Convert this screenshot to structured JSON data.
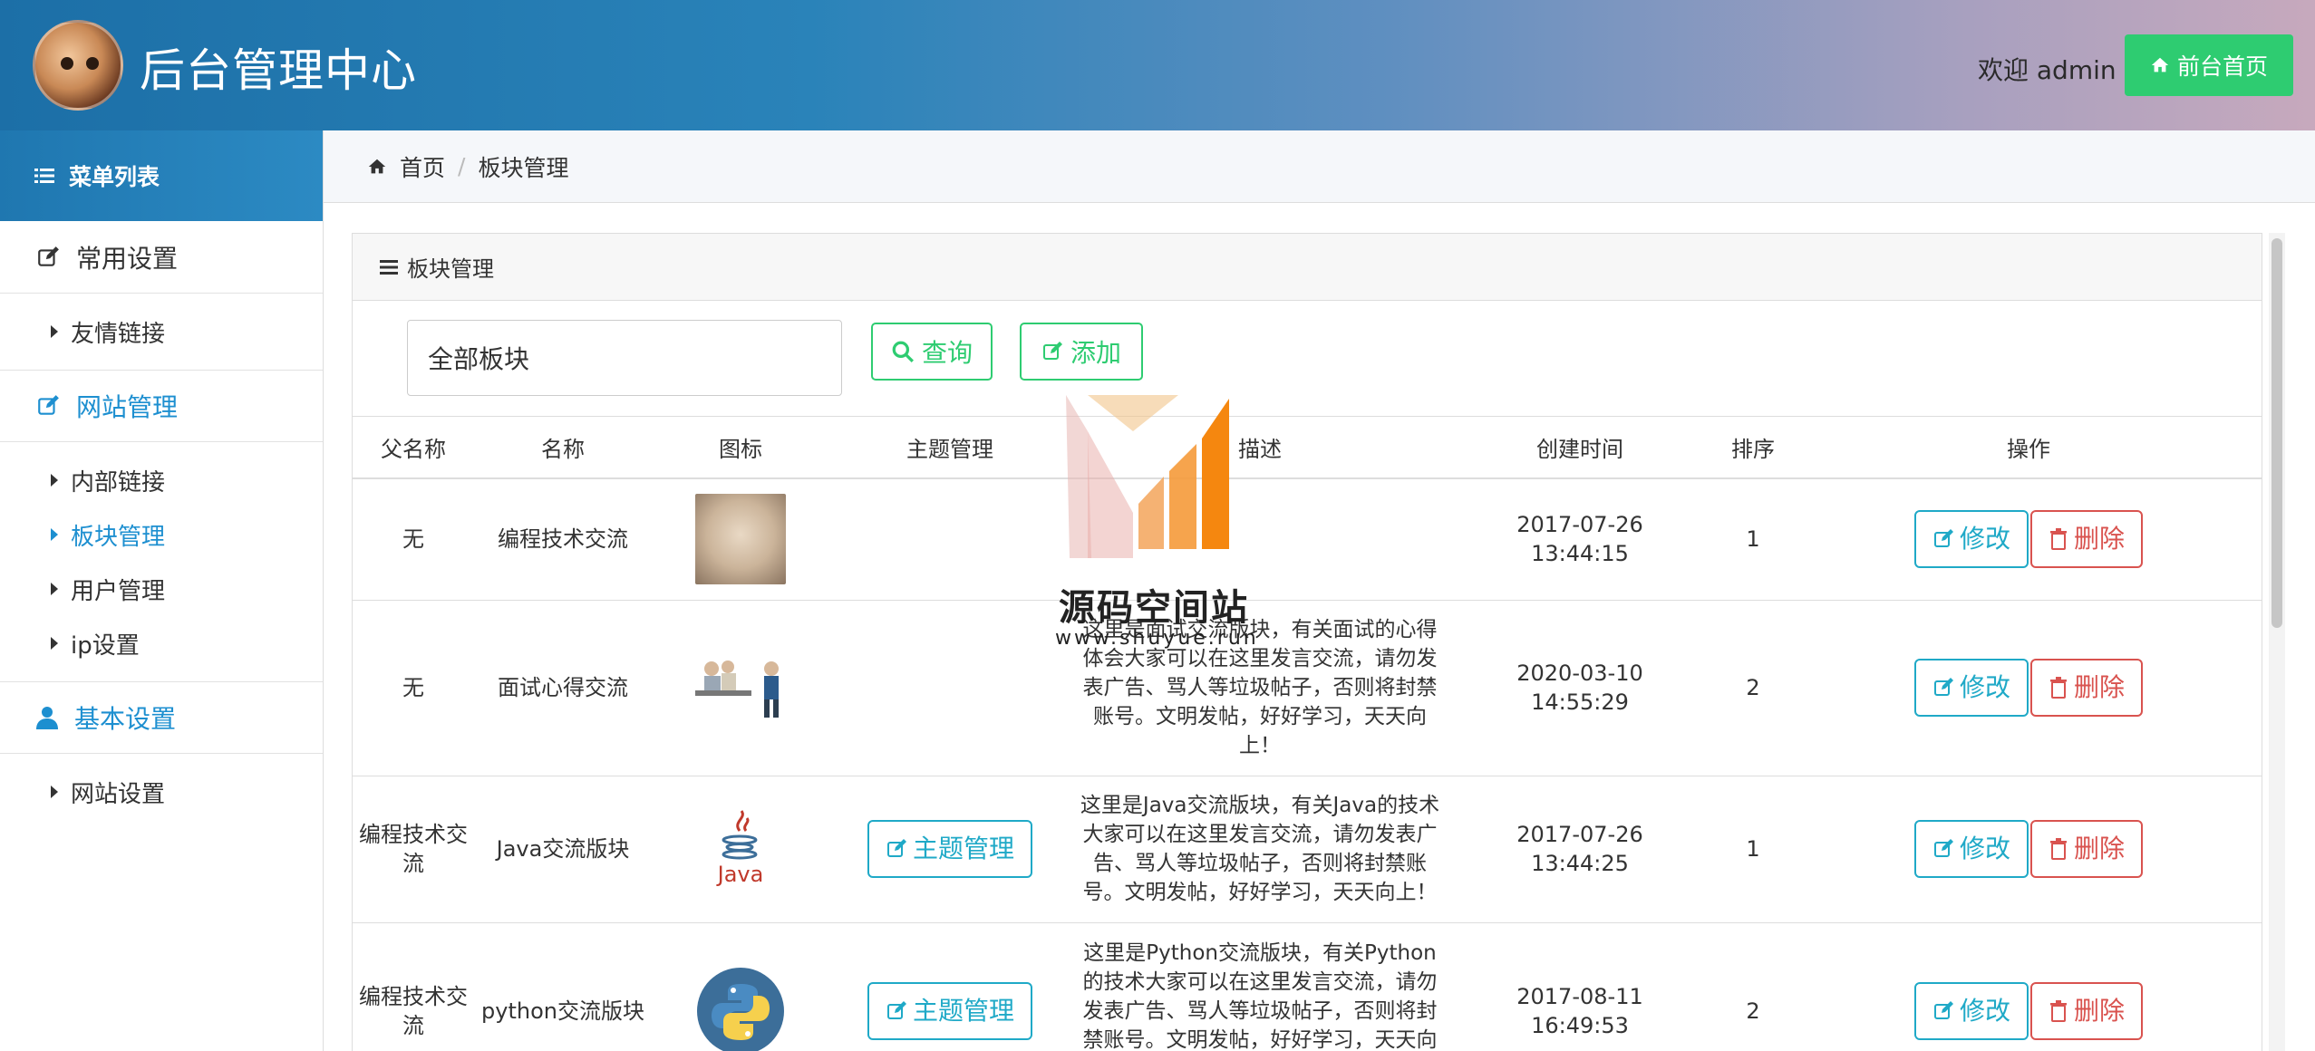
{
  "header": {
    "title": "后台管理中心",
    "welcome": "欢迎 admin",
    "home_button": "前台首页"
  },
  "sidebar": {
    "heading": "菜单列表",
    "groups": [
      {
        "label": "常用设置",
        "items": [
          "友情链接"
        ]
      },
      {
        "label": "网站管理",
        "items": [
          "内部链接",
          "板块管理",
          "用户管理",
          "ip设置"
        ]
      },
      {
        "label": "基本设置",
        "items": [
          "网站设置"
        ]
      }
    ]
  },
  "breadcrumb": {
    "home": "首页",
    "current": "板块管理"
  },
  "panel": {
    "title": "板块管理",
    "filter_value": "全部板块",
    "search_button": "查询",
    "add_button": "添加"
  },
  "table": {
    "headers": [
      "父名称",
      "名称",
      "图标",
      "主题管理",
      "描述",
      "创建时间",
      "排序",
      "操作"
    ],
    "topic_button": "主题管理",
    "edit_button": "修改",
    "delete_button": "删除",
    "rows": [
      {
        "parent": "无",
        "name": "编程技术交流",
        "desc": "",
        "date": "2017-07-26",
        "time": "13:44:15",
        "order": "1"
      },
      {
        "parent": "无",
        "name": "面试心得交流",
        "desc": "这里是面试交流版块，有关面试的心得体会大家可以在这里发言交流，请勿发表广告、骂人等垃圾帖子，否则将封禁账号。文明发帖，好好学习，天天向上！",
        "date": "2020-03-10",
        "time": "14:55:29",
        "order": "2"
      },
      {
        "parent": "编程技术交流",
        "name": "Java交流版块",
        "desc": "这里是Java交流版块，有关Java的技术大家可以在这里发言交流，请勿发表广告、骂人等垃圾帖子，否则将封禁账号。文明发帖，好好学习，天天向上！",
        "date": "2017-07-26",
        "time": "13:44:25",
        "order": "1"
      },
      {
        "parent": "编程技术交流",
        "name": "python交流版块",
        "desc": "这里是Python交流版块，有关Python的技术大家可以在这里发言交流，请勿发表广告、骂人等垃圾帖子，否则将封禁账号。文明发帖，好好学习，天天向上！",
        "date": "2017-08-11",
        "time": "16:49:53",
        "order": "2"
      }
    ]
  },
  "watermark": {
    "text": "源码空间站",
    "url": "www.shuyue.run"
  },
  "icons": {
    "java_label": "Java"
  }
}
